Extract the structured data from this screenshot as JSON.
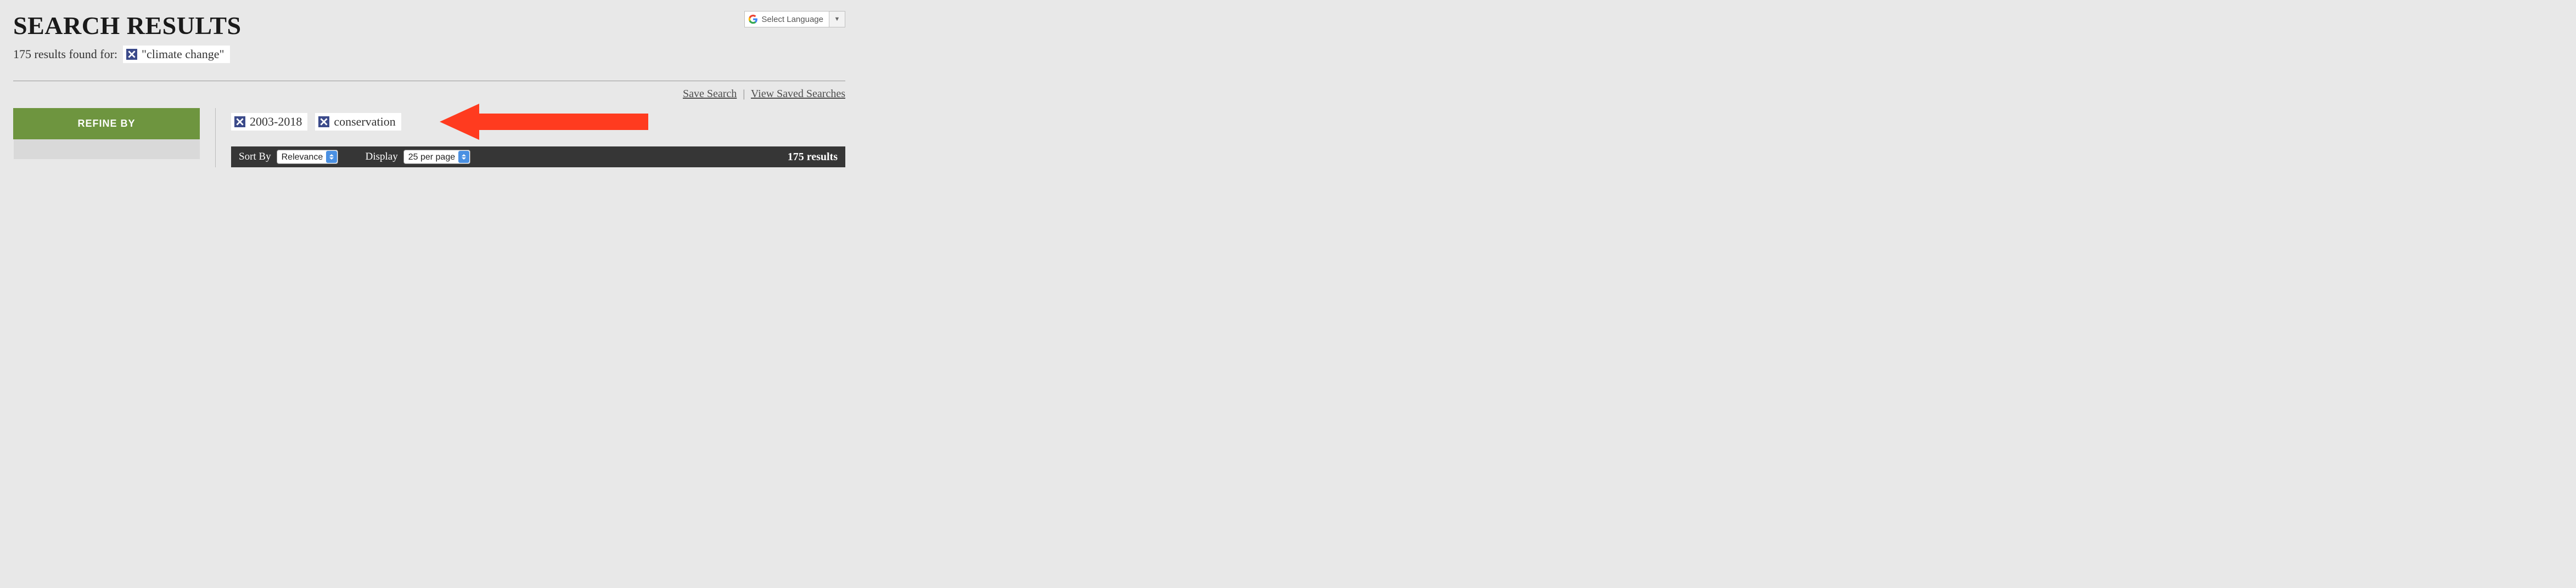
{
  "header": {
    "title": "SEARCH RESULTS",
    "language_label": "Select Language"
  },
  "summary": {
    "count_text": "175 results found for:",
    "query": "\"climate change\""
  },
  "links": {
    "save": "Save Search",
    "view": "View Saved Searches"
  },
  "sidebar": {
    "refine_label": "REFINE BY"
  },
  "filters": [
    {
      "label": "2003-2018"
    },
    {
      "label": "conservation"
    }
  ],
  "sortbar": {
    "sort_label": "Sort By",
    "sort_options": [
      "Relevance"
    ],
    "sort_selected": "Relevance",
    "display_label": "Display",
    "display_options": [
      "25 per page"
    ],
    "display_selected": "25 per page",
    "results_text": "175 results"
  }
}
